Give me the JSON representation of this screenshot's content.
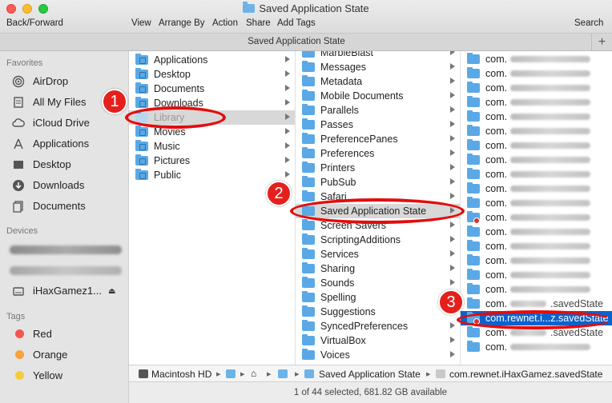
{
  "window": {
    "title": "Saved Application State",
    "toolbar": {
      "back_forward": "Back/Forward",
      "view": "View",
      "arrange_by": "Arrange By",
      "action": "Action",
      "share": "Share",
      "add_tags": "Add Tags",
      "search": "Search"
    },
    "tab_title": "Saved Application State",
    "tab_plus": "+"
  },
  "sidebar": {
    "favorites_header": "Favorites",
    "favorites": [
      {
        "label": "AirDrop",
        "icon": "airdrop-icon"
      },
      {
        "label": "All My Files",
        "icon": "all-files-icon"
      },
      {
        "label": "iCloud Drive",
        "icon": "cloud-icon"
      },
      {
        "label": "Applications",
        "icon": "applications-icon"
      },
      {
        "label": "Desktop",
        "icon": "desktop-icon"
      },
      {
        "label": "Downloads",
        "icon": "downloads-icon"
      },
      {
        "label": "Documents",
        "icon": "documents-icon"
      }
    ],
    "devices_header": "Devices",
    "devices": [
      {
        "label": "iHaxGamez1...",
        "icon": "drive-icon"
      }
    ],
    "tags_header": "Tags",
    "tags": [
      {
        "label": "Red",
        "color": "#f2574f"
      },
      {
        "label": "Orange",
        "color": "#f5a33b"
      },
      {
        "label": "Yellow",
        "color": "#f5cd3b"
      }
    ]
  },
  "column1": [
    {
      "label": "Applications",
      "glyph": true
    },
    {
      "label": "Desktop",
      "glyph": true
    },
    {
      "label": "Documents",
      "glyph": true
    },
    {
      "label": "Downloads",
      "glyph": true
    },
    {
      "label": "Library",
      "glyph": false,
      "state": "gray"
    },
    {
      "label": "Movies",
      "glyph": true
    },
    {
      "label": "Music",
      "glyph": true
    },
    {
      "label": "Pictures",
      "glyph": true
    },
    {
      "label": "Public",
      "glyph": true
    }
  ],
  "column2": [
    {
      "label": "MarbleBlast"
    },
    {
      "label": "Messages"
    },
    {
      "label": "Metadata"
    },
    {
      "label": "Mobile Documents"
    },
    {
      "label": "Parallels"
    },
    {
      "label": "Passes"
    },
    {
      "label": "PreferencePanes"
    },
    {
      "label": "Preferences"
    },
    {
      "label": "Printers"
    },
    {
      "label": "PubSub"
    },
    {
      "label": "Safari"
    },
    {
      "label": "Saved Application State",
      "state": "gray"
    },
    {
      "label": "Screen Savers"
    },
    {
      "label": "ScriptingAdditions"
    },
    {
      "label": "Services"
    },
    {
      "label": "Sharing"
    },
    {
      "label": "Sounds"
    },
    {
      "label": "Spelling"
    },
    {
      "label": "Suggestions"
    },
    {
      "label": "SyncedPreferences"
    },
    {
      "label": "VirtualBox"
    },
    {
      "label": "Voices"
    }
  ],
  "column3": [
    {
      "label": "com."
    },
    {
      "label": "com."
    },
    {
      "label": "com."
    },
    {
      "label": "com."
    },
    {
      "label": "com."
    },
    {
      "label": "com."
    },
    {
      "label": "com."
    },
    {
      "label": "com."
    },
    {
      "label": "com."
    },
    {
      "label": "com."
    },
    {
      "label": "com."
    },
    {
      "label": "com."
    },
    {
      "label": "com."
    },
    {
      "label": "com."
    },
    {
      "label": "com."
    },
    {
      "label": "com."
    },
    {
      "label": "com."
    },
    {
      "label": "com.",
      "suffix": ".savedState"
    },
    {
      "label": "com.rewnet.i...z.savedState",
      "state": "blue"
    },
    {
      "label": "com.",
      "suffix": ".savedState"
    },
    {
      "label": "com."
    }
  ],
  "pathbar": {
    "hd": "Macintosh HD",
    "saved_state": "Saved Application State",
    "item": "com.rewnet.iHaxGamez.savedState"
  },
  "status": "1 of 44 selected, 681.82 GB available",
  "annotations": [
    "1",
    "2",
    "3"
  ],
  "colors": {
    "annotation": "#e30d0d",
    "selection": "#0a62cf",
    "folder": "#5aa9e6"
  }
}
